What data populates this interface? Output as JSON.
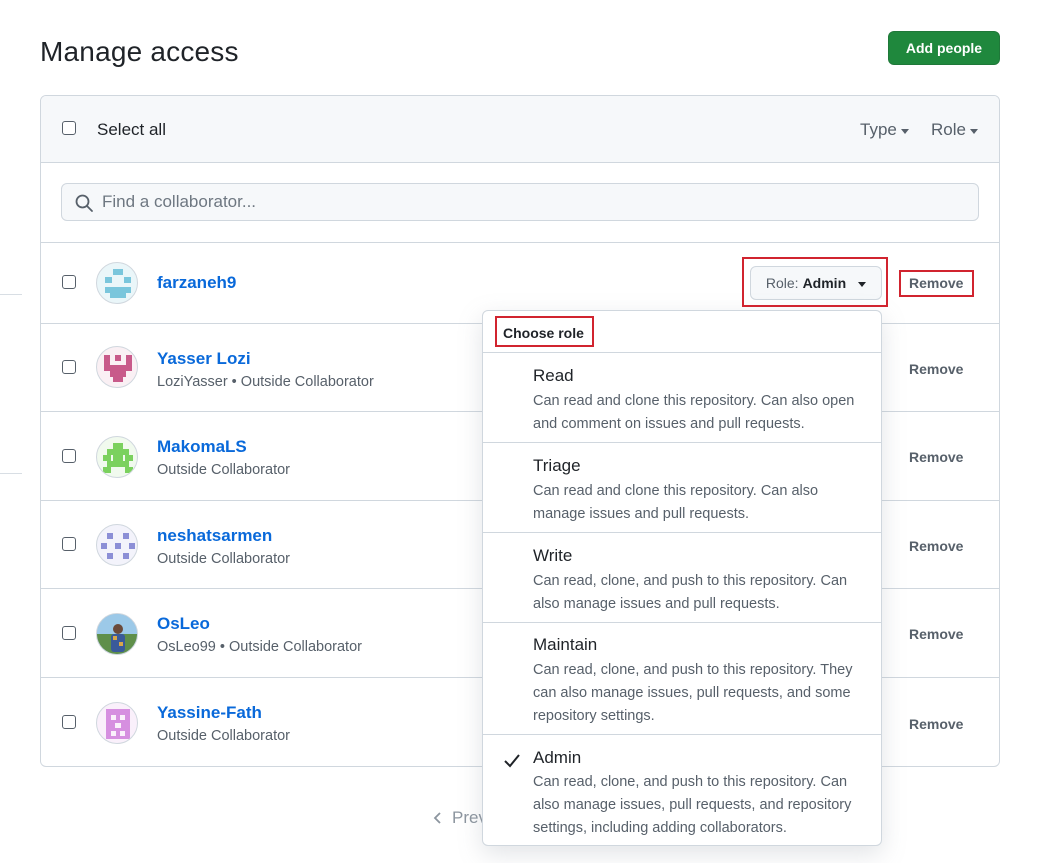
{
  "page": {
    "title": "Manage access",
    "add_button": "Add people"
  },
  "header": {
    "select_all": "Select all",
    "type_filter": "Type",
    "role_filter": "Role"
  },
  "search": {
    "placeholder": "Find a collaborator..."
  },
  "collaborators": [
    {
      "name": "farzaneh9",
      "sub": "",
      "remove": "Remove",
      "role_prefix": "Role:",
      "role_value": "Admin"
    },
    {
      "name": "Yasser Lozi",
      "sub": "LoziYasser • Outside Collaborator",
      "remove": "Remove"
    },
    {
      "name": "MakomaLS",
      "sub": "Outside Collaborator",
      "remove": "Remove"
    },
    {
      "name": "neshatsarmen",
      "sub": "Outside Collaborator",
      "remove": "Remove"
    },
    {
      "name": "OsLeo",
      "sub": "OsLeo99 • Outside Collaborator",
      "remove": "Remove"
    },
    {
      "name": "Yassine-Fath",
      "sub": "Outside Collaborator",
      "remove": "Remove"
    }
  ],
  "role_menu": {
    "title": "Choose role",
    "selected": "Admin",
    "items": [
      {
        "name": "Read",
        "desc": "Can read and clone this repository. Can also open and comment on issues and pull requests."
      },
      {
        "name": "Triage",
        "desc": "Can read and clone this repository. Can also manage issues and pull requests."
      },
      {
        "name": "Write",
        "desc": "Can read, clone, and push to this repository. Can also manage issues and pull requests."
      },
      {
        "name": "Maintain",
        "desc": "Can read, clone, and push to this repository. They can also manage issues, pull requests, and some repository settings."
      },
      {
        "name": "Admin",
        "desc": "Can read, clone, and push to this repository. Can also manage issues, pull requests, and repository settings, including adding collaborators."
      }
    ]
  },
  "pagination": {
    "prev": "Prev"
  },
  "colors": {
    "accent_green": "#1f883d",
    "link_blue": "#0969da",
    "highlight_red": "#d1242f"
  }
}
